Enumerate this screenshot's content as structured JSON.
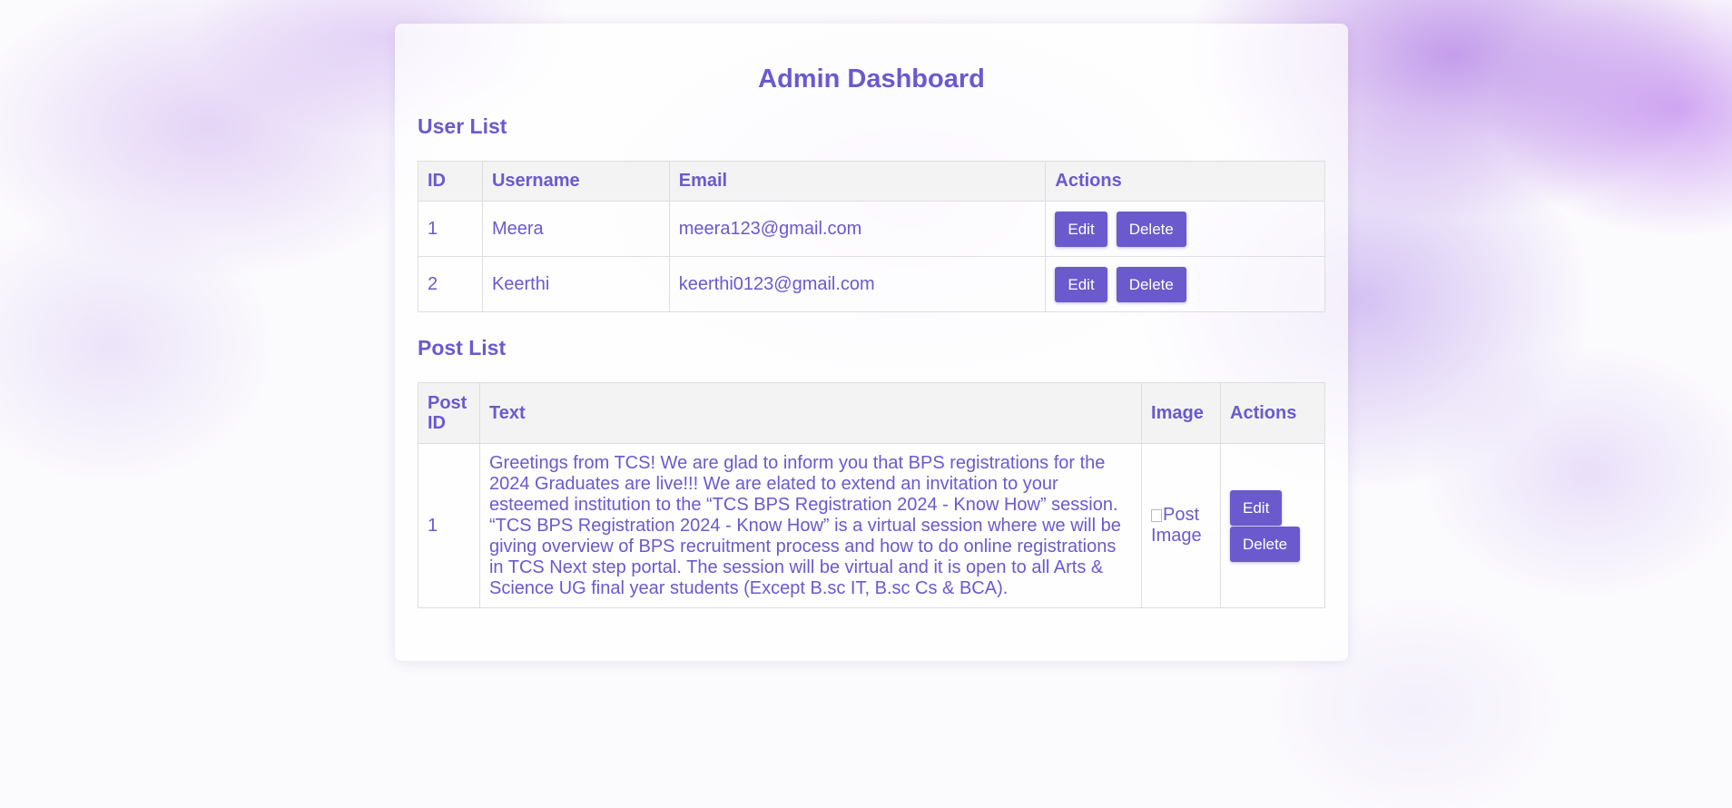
{
  "header": {
    "title": "Admin Dashboard"
  },
  "users": {
    "title": "User List",
    "columns": [
      "ID",
      "Username",
      "Email",
      "Actions"
    ],
    "rows": [
      {
        "id": "1",
        "username": "Meera",
        "email": "meera123@gmail.com",
        "edit": "Edit",
        "delete": "Delete"
      },
      {
        "id": "2",
        "username": "Keerthi",
        "email": "keerthi0123@gmail.com",
        "edit": "Edit",
        "delete": "Delete"
      }
    ]
  },
  "posts": {
    "title": "Post List",
    "columns": [
      "Post ID",
      "Text",
      "Image",
      "Actions"
    ],
    "rows": [
      {
        "id": "1",
        "text": "Greetings from TCS! We are glad to inform you that BPS registrations for the 2024 Graduates are live!!! We are elated to extend an invitation to your esteemed institution to the “TCS BPS Registration 2024 - Know How” session. “TCS BPS Registration 2024 - Know How” is a virtual session where we will be giving overview of BPS recruitment process and how to do online registrations in TCS Next step portal. The session will be virtual and it is open to all Arts & Science UG final year students (Except B.sc IT, B.sc Cs & BCA).",
        "image_alt": "Post Image",
        "edit": "Edit",
        "delete": "Delete"
      }
    ]
  },
  "colors": {
    "accent": "#6a5acd",
    "button_text": "#ffffff",
    "header_bg": "#f2f2f2",
    "border": "#dedede"
  }
}
